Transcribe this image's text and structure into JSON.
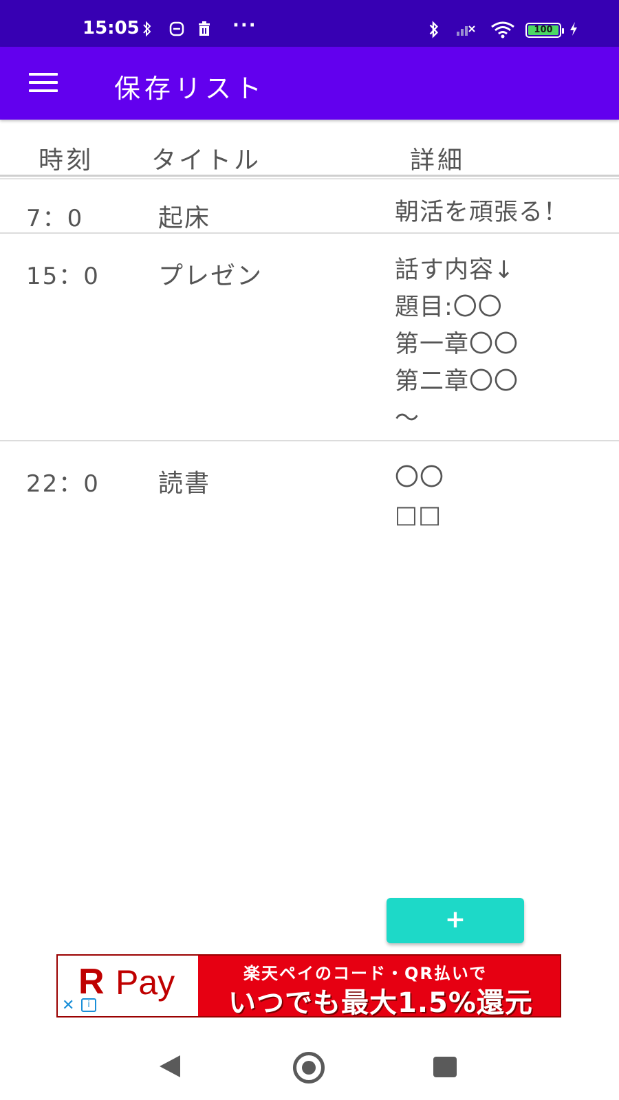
{
  "status_bar": {
    "time": "15:05",
    "left_icons": [
      "bluetooth-icon",
      "app-notification-icon",
      "trash-icon"
    ],
    "more": "···",
    "right_icons": [
      "bluetooth-icon",
      "signal-off-icon",
      "wifi-icon",
      "battery-icon",
      "charging-icon"
    ],
    "battery_level": "100",
    "background": "#3700b3"
  },
  "app_bar": {
    "title": "保存リスト",
    "menu_icon": "hamburger-menu-icon",
    "background": "#6200ee"
  },
  "columns": {
    "time": "時刻",
    "title": "タイトル",
    "detail": "詳細"
  },
  "rows": [
    {
      "time": "7：0",
      "title": "起床",
      "detail": "朝活を頑張る！"
    },
    {
      "time": "15：0",
      "title": "プレゼン",
      "detail": "話す内容↓\n題目:〇〇\n第一章〇〇\n第二章〇〇\n～"
    },
    {
      "time": "22：0",
      "title": "読書",
      "detail": "〇〇\n□□"
    }
  ],
  "add_button": {
    "label": "+",
    "color": "#1dd9c8"
  },
  "ad": {
    "logo_r": "R",
    "logo_pay": "Pay",
    "line1": "楽天ペイのコード・QR払いで",
    "line2": "いつでも最大1.5%還元",
    "close": "✕",
    "info": "i",
    "color": "#e60012"
  },
  "nav_bar": {
    "icons": [
      "back-icon",
      "home-icon",
      "recent-apps-icon"
    ]
  }
}
